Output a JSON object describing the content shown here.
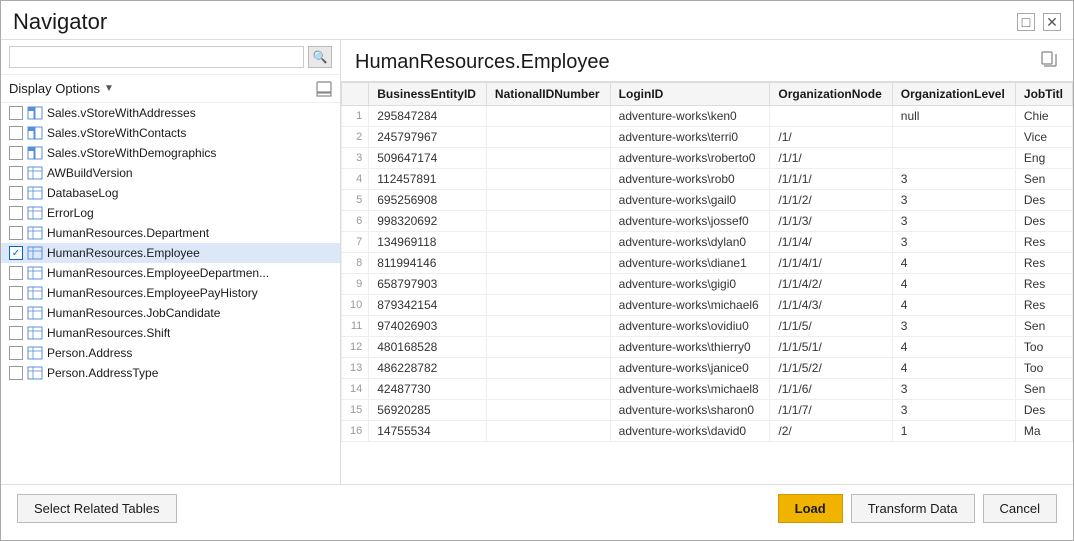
{
  "titlebar": {
    "title": "Navigator",
    "controls": [
      "□",
      "✕"
    ]
  },
  "left": {
    "search_placeholder": "",
    "display_options_label": "Display Options",
    "items": [
      {
        "label": "Sales.vStoreWithAddresses",
        "type": "view",
        "checked": false,
        "selected": false
      },
      {
        "label": "Sales.vStoreWithContacts",
        "type": "view",
        "checked": false,
        "selected": false
      },
      {
        "label": "Sales.vStoreWithDemographics",
        "type": "view",
        "checked": false,
        "selected": false
      },
      {
        "label": "AWBuildVersion",
        "type": "table",
        "checked": false,
        "selected": false
      },
      {
        "label": "DatabaseLog",
        "type": "table",
        "checked": false,
        "selected": false
      },
      {
        "label": "ErrorLog",
        "type": "table",
        "checked": false,
        "selected": false
      },
      {
        "label": "HumanResources.Department",
        "type": "table",
        "checked": false,
        "selected": false
      },
      {
        "label": "HumanResources.Employee",
        "type": "table",
        "checked": true,
        "selected": true
      },
      {
        "label": "HumanResources.EmployeeDepartmen...",
        "type": "table",
        "checked": false,
        "selected": false
      },
      {
        "label": "HumanResources.EmployeePayHistory",
        "type": "table",
        "checked": false,
        "selected": false
      },
      {
        "label": "HumanResources.JobCandidate",
        "type": "table",
        "checked": false,
        "selected": false
      },
      {
        "label": "HumanResources.Shift",
        "type": "table",
        "checked": false,
        "selected": false
      },
      {
        "label": "Person.Address",
        "type": "table",
        "checked": false,
        "selected": false
      },
      {
        "label": "Person.AddressType",
        "type": "table",
        "checked": false,
        "selected": false
      }
    ]
  },
  "right": {
    "title": "HumanResources.Employee",
    "columns": [
      "BusinessEntityID",
      "NationalIDNumber",
      "LoginID",
      "OrganizationNode",
      "OrganizationLevel",
      "JobTitl"
    ],
    "rows": [
      {
        "num": 1,
        "BusinessEntityID": "295847284",
        "NationalIDNumber": "",
        "LoginID": "adventure-works\\ken0",
        "OrganizationNode": "",
        "OrganizationLevel": "null",
        "JobTitle": "Chie"
      },
      {
        "num": 2,
        "BusinessEntityID": "245797967",
        "NationalIDNumber": "",
        "LoginID": "adventure-works\\terri0",
        "OrganizationNode": "/1/",
        "OrganizationLevel": "",
        "JobTitle": "Vice"
      },
      {
        "num": 3,
        "BusinessEntityID": "509647174",
        "NationalIDNumber": "",
        "LoginID": "adventure-works\\roberto0",
        "OrganizationNode": "/1/1/",
        "OrganizationLevel": "",
        "JobTitle": "Eng"
      },
      {
        "num": 4,
        "BusinessEntityID": "112457891",
        "NationalIDNumber": "",
        "LoginID": "adventure-works\\rob0",
        "OrganizationNode": "/1/1/1/",
        "OrganizationLevel": "3",
        "JobTitle": "Sen"
      },
      {
        "num": 5,
        "BusinessEntityID": "695256908",
        "NationalIDNumber": "",
        "LoginID": "adventure-works\\gail0",
        "OrganizationNode": "/1/1/2/",
        "OrganizationLevel": "3",
        "JobTitle": "Des"
      },
      {
        "num": 6,
        "BusinessEntityID": "998320692",
        "NationalIDNumber": "",
        "LoginID": "adventure-works\\jossef0",
        "OrganizationNode": "/1/1/3/",
        "OrganizationLevel": "3",
        "JobTitle": "Des"
      },
      {
        "num": 7,
        "BusinessEntityID": "134969118",
        "NationalIDNumber": "",
        "LoginID": "adventure-works\\dylan0",
        "OrganizationNode": "/1/1/4/",
        "OrganizationLevel": "3",
        "JobTitle": "Res"
      },
      {
        "num": 8,
        "BusinessEntityID": "811994146",
        "NationalIDNumber": "",
        "LoginID": "adventure-works\\diane1",
        "OrganizationNode": "/1/1/4/1/",
        "OrganizationLevel": "4",
        "JobTitle": "Res"
      },
      {
        "num": 9,
        "BusinessEntityID": "658797903",
        "NationalIDNumber": "",
        "LoginID": "adventure-works\\gigi0",
        "OrganizationNode": "/1/1/4/2/",
        "OrganizationLevel": "4",
        "JobTitle": "Res"
      },
      {
        "num": 10,
        "BusinessEntityID": "879342154",
        "NationalIDNumber": "",
        "LoginID": "adventure-works\\michael6",
        "OrganizationNode": "/1/1/4/3/",
        "OrganizationLevel": "4",
        "JobTitle": "Res"
      },
      {
        "num": 11,
        "BusinessEntityID": "974026903",
        "NationalIDNumber": "",
        "LoginID": "adventure-works\\ovidiu0",
        "OrganizationNode": "/1/1/5/",
        "OrganizationLevel": "3",
        "JobTitle": "Sen"
      },
      {
        "num": 12,
        "BusinessEntityID": "480168528",
        "NationalIDNumber": "",
        "LoginID": "adventure-works\\thierry0",
        "OrganizationNode": "/1/1/5/1/",
        "OrganizationLevel": "4",
        "JobTitle": "Too"
      },
      {
        "num": 13,
        "BusinessEntityID": "486228782",
        "NationalIDNumber": "",
        "LoginID": "adventure-works\\janice0",
        "OrganizationNode": "/1/1/5/2/",
        "OrganizationLevel": "4",
        "JobTitle": "Too"
      },
      {
        "num": 14,
        "BusinessEntityID": "42487730",
        "NationalIDNumber": "",
        "LoginID": "adventure-works\\michael8",
        "OrganizationNode": "/1/1/6/",
        "OrganizationLevel": "3",
        "JobTitle": "Sen"
      },
      {
        "num": 15,
        "BusinessEntityID": "56920285",
        "NationalIDNumber": "",
        "LoginID": "adventure-works\\sharon0",
        "OrganizationNode": "/1/1/7/",
        "OrganizationLevel": "3",
        "JobTitle": "Des"
      },
      {
        "num": 16,
        "BusinessEntityID": "14755534",
        "NationalIDNumber": "",
        "LoginID": "adventure-works\\david0",
        "OrganizationNode": "/2/",
        "OrganizationLevel": "1",
        "JobTitle": "Ma"
      }
    ]
  },
  "bottom": {
    "select_related_tables_label": "Select Related Tables",
    "load_label": "Load",
    "transform_data_label": "Transform Data",
    "cancel_label": "Cancel"
  }
}
